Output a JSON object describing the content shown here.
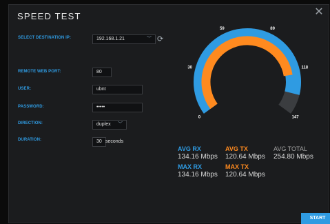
{
  "dialog": {
    "title": "SPEED TEST"
  },
  "form": {
    "destination_label": "SELECT DESTINATION IP:",
    "destination_value": "192.168.1.21",
    "port_label": "REMOTE WEB PORT:",
    "port_value": "80",
    "user_label": "USER:",
    "user_value": "ubnt",
    "password_label": "PASSWORD:",
    "password_value": "•••••",
    "direction_label": "DIRECTION:",
    "direction_value": "duplex",
    "duration_label": "DURATION:",
    "duration_value": "30",
    "duration_unit": "seconds"
  },
  "gauge": {
    "ticks": [
      "0",
      "30",
      "59",
      "89",
      "118",
      "147"
    ],
    "max": 147,
    "rx_value": 134.16,
    "tx_value": 120.64,
    "colors": {
      "rx": "#2f9be2",
      "tx": "#ff8a1f",
      "track": "#3b3d40"
    }
  },
  "stats": {
    "avg_rx_label": "AVG RX",
    "avg_rx_value": "134.16 Mbps",
    "avg_tx_label": "AVG TX",
    "avg_tx_value": "120.64 Mbps",
    "avg_total_label": "AVG TOTAL",
    "avg_total_value": "254.80 Mbps",
    "max_rx_label": "MAX RX",
    "max_rx_value": "134.16 Mbps",
    "max_tx_label": "MAX TX",
    "max_tx_value": "120.64 Mbps"
  },
  "actions": {
    "start_label": "START"
  },
  "icons": {
    "close": "close-icon",
    "refresh": "refresh-icon",
    "dropdown": "chevron-down-icon"
  }
}
